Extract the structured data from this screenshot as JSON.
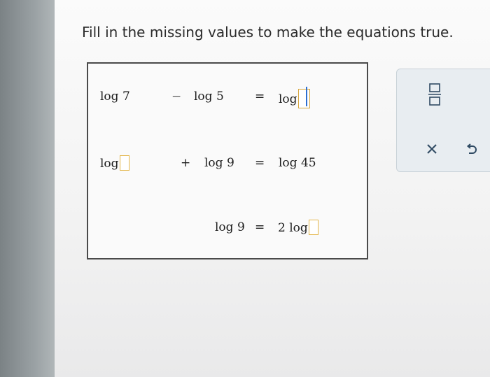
{
  "instructions": "Fill in the missing values to make the equations true.",
  "equations": [
    {
      "left_term": "log 7",
      "operator": "−",
      "right_term": "log 5",
      "equals": "=",
      "result_prefix": "log",
      "result_suffix": ""
    },
    {
      "left_prefix": "log",
      "operator": "+",
      "right_term": "log 9",
      "equals": "=",
      "result": "log 45"
    },
    {
      "left_term": "log 9",
      "equals": "=",
      "result_prefix": "2 log"
    }
  ],
  "input_values": {
    "eq1_result": "",
    "eq2_left": "",
    "eq3_result": ""
  },
  "toolbar": {
    "fraction_icon": "fraction-icon",
    "clear_icon": "close-icon",
    "undo_icon": "undo-icon"
  },
  "colors": {
    "input_border": "#e3b64a",
    "toolbar_bg": "#e8edf1",
    "icon": "#2f4a63"
  }
}
